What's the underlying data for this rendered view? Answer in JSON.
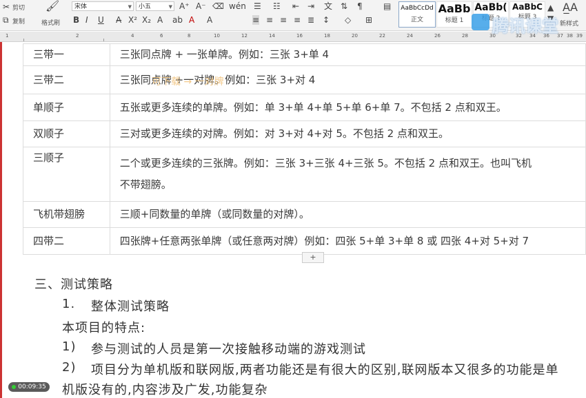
{
  "ribbon": {
    "clipboard": {
      "cut": "剪切",
      "copy": "复制",
      "format_painter": "格式刷"
    },
    "font_name": "宋体",
    "font_size": "小五",
    "styles": [
      {
        "sample": "AaBbCcDd",
        "label": "正文"
      },
      {
        "sample": "AaBb",
        "label": "标题 1"
      },
      {
        "sample": "AaBb(",
        "label": "标题 2"
      },
      {
        "sample": "AaBbC",
        "label": "标题 3"
      }
    ],
    "new_style_label": "新样式",
    "accent_color": "#c00000"
  },
  "ruler": {
    "numbers": [
      "1",
      "2",
      "4",
      "6",
      "8",
      "10",
      "12",
      "14",
      "16",
      "18",
      "20",
      "22",
      "24",
      "26",
      "28",
      "30",
      "32",
      "34",
      "36",
      "37",
      "38",
      "39"
    ]
  },
  "watermark": "可下载 → 一对牌",
  "table": {
    "rows": [
      {
        "name": "三带一",
        "desc": "三张同点牌 + 一张单牌。例如：三张 3+单 4"
      },
      {
        "name": "三带二",
        "desc": "三张同点牌 +一对牌。例如：三张 3+对 4"
      },
      {
        "name": "单顺子",
        "desc": "五张或更多连续的单牌。例如：单 3+单 4+单 5+单 6+单 7。不包括 2 点和双王。"
      },
      {
        "name": "双顺子",
        "desc": "三对或更多连续的对牌。例如：对 3+对 4+对 5。不包括 2 点和双王。"
      },
      {
        "name": "三顺子",
        "desc": "二个或更多连续的三张牌。例如：三张 3+三张 4+三张 5。不包括 2 点和双王。也叫飞机",
        "desc2": "不带翅膀。"
      },
      {
        "name": "飞机带翅膀",
        "desc": "三顺+同数量的单牌（或同数量的对牌）。"
      },
      {
        "name": "四带二",
        "desc": "四张牌+任意两张单牌（或任意两对牌）例如：四张 5+单 3+单 8 或 四张 4+对 5+对 7"
      }
    ],
    "add_row": "+"
  },
  "content": {
    "section_heading": "三、测试策略",
    "subheading_num": "1.",
    "subheading": "整体测试策略",
    "features_label": "本项目的特点:",
    "items": [
      {
        "num": "1)",
        "text": "参与测试的人员是第一次接触移动端的游戏测试"
      },
      {
        "num": "2)",
        "text": "项目分为单机版和联网版,两者功能还是有很大的区别,联网版本又很多的功能是单"
      }
    ],
    "continuation": "机版没有的,内容涉及广发,功能复杂"
  },
  "brand_overlay": "腾讯课堂",
  "timer": "00:09:35"
}
